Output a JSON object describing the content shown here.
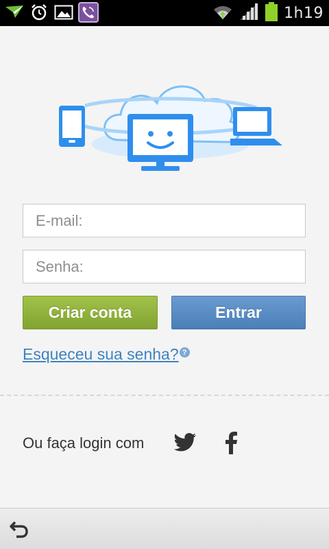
{
  "status_bar": {
    "time": "1h19",
    "left_icons": [
      "send-icon",
      "alarm-icon",
      "image-icon",
      "viber-icon"
    ],
    "right_icons": [
      "wifi-icon",
      "signal-icon",
      "battery-icon"
    ]
  },
  "hero": {
    "icon": "cloud-devices-illustration"
  },
  "form": {
    "email_placeholder": "E-mail:",
    "email_value": "",
    "password_placeholder": "Senha:",
    "password_value": ""
  },
  "buttons": {
    "create_account": "Criar conta",
    "login": "Entrar"
  },
  "forgot": {
    "link": "Esqueceu sua senha?",
    "help_icon": "question-icon"
  },
  "social": {
    "label": "Ou faça login com",
    "providers": [
      "twitter-icon",
      "facebook-icon"
    ]
  },
  "nav": {
    "back_icon": "back-icon"
  },
  "colors": {
    "accent_blue": "#2f8eed",
    "create_green": "#8fb23b",
    "login_blue": "#5a8cc4",
    "link_blue": "#3f82c2",
    "status_bar": "#000000",
    "background": "#f4f4f4"
  }
}
